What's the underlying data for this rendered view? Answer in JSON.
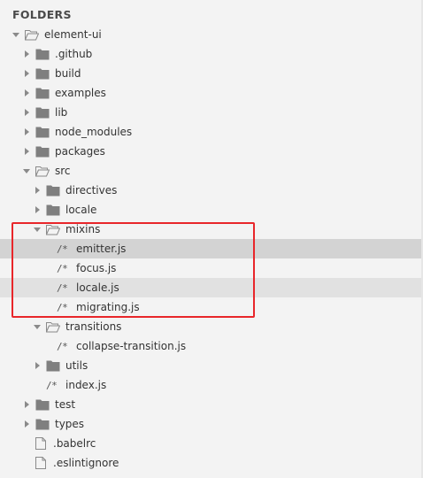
{
  "sidebar": {
    "header": "FOLDERS"
  },
  "tree": {
    "root": "element-ui",
    "github": ".github",
    "build": "build",
    "examples": "examples",
    "lib": "lib",
    "node_modules": "node_modules",
    "packages": "packages",
    "src": "src",
    "directives": "directives",
    "locale": "locale",
    "mixins": "mixins",
    "emitter": "emitter.js",
    "focus": "focus.js",
    "locale_js": "locale.js",
    "migrating": "migrating.js",
    "transitions": "transitions",
    "collapse": "collapse-transition.js",
    "utils": "utils",
    "index": "index.js",
    "test": "test",
    "types": "types",
    "babelrc": ".babelrc",
    "eslintignore": ".eslintignore"
  },
  "icons": {
    "js_glyph": "/*",
    "folder": "folder-icon",
    "folder_open": "folder-open-icon",
    "file": "file-icon"
  },
  "colors": {
    "background": "#f3f3f3",
    "selected_row": "#d3d3d3",
    "highlight_border": "#e8262a",
    "folder_outline": "#8a8a8a"
  }
}
